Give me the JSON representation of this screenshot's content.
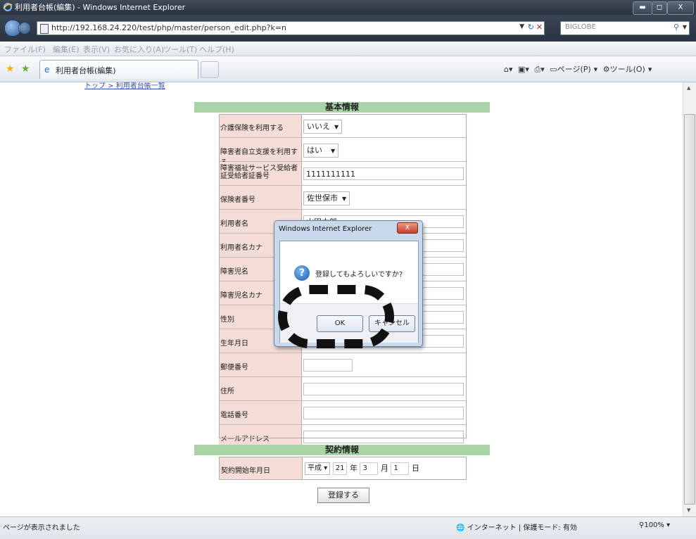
{
  "window": {
    "title": "利用者台帳(編集) - Windows Internet Explorer"
  },
  "address": {
    "url": "http://192.168.24.220/test/php/master/person_edit.php?k=n",
    "search_placeholder": "BIGLOBE"
  },
  "menu": [
    "ファイル(F)",
    "編集(E)",
    "表示(V)",
    "お気に入り(A)",
    "ツール(T)",
    "ヘルプ(H)"
  ],
  "tab": {
    "label": "利用者台帳(編集)"
  },
  "commandbar": {
    "page": "ページ(P)",
    "tools": "ツール(O)"
  },
  "breadcrumb": "トップ > 利用者台帳一覧",
  "section_basic": "基本情報",
  "section_contract": "契約情報",
  "fields": [
    {
      "label": "介護保険を利用する",
      "type": "select",
      "value": "いいえ"
    },
    {
      "label": "障害者自立支援を利用する",
      "type": "select",
      "value": "はい"
    },
    {
      "label": "障害福祉サービス受給者証受給者証番号",
      "type": "text",
      "value": "1111111111"
    },
    {
      "label": "保険者番号",
      "type": "select",
      "value": "佐世保市"
    },
    {
      "label": "利用者名",
      "type": "text",
      "value": "山田太郎"
    },
    {
      "label": "利用者名カナ",
      "type": "text",
      "value": ""
    },
    {
      "label": "障害児名",
      "type": "text",
      "value": ""
    },
    {
      "label": "障害児名カナ",
      "type": "text",
      "value": ""
    },
    {
      "label": "性別",
      "type": "text",
      "value": ""
    },
    {
      "label": "生年月日",
      "type": "text",
      "value": ""
    },
    {
      "label": "郵便番号",
      "type": "text",
      "value": ""
    },
    {
      "label": "住所",
      "type": "text",
      "value": ""
    },
    {
      "label": "電話番号",
      "type": "text",
      "value": ""
    },
    {
      "label": "メールアドレス",
      "type": "text",
      "value": ""
    }
  ],
  "contract": {
    "label": "契約開始年月日",
    "era": "平成",
    "year": "21",
    "year_unit": "年",
    "month": "3",
    "month_unit": "月",
    "day": "1",
    "day_unit": "日"
  },
  "register_button": "登録する",
  "dialog": {
    "title": "Windows Internet Explorer",
    "message": "登録してもよろしいですか?",
    "ok": "OK",
    "cancel": "キャンセル"
  },
  "status": {
    "text": "ページが表示されました",
    "zone": "インターネット | 保護モード: 有効",
    "zoom": "100%"
  }
}
